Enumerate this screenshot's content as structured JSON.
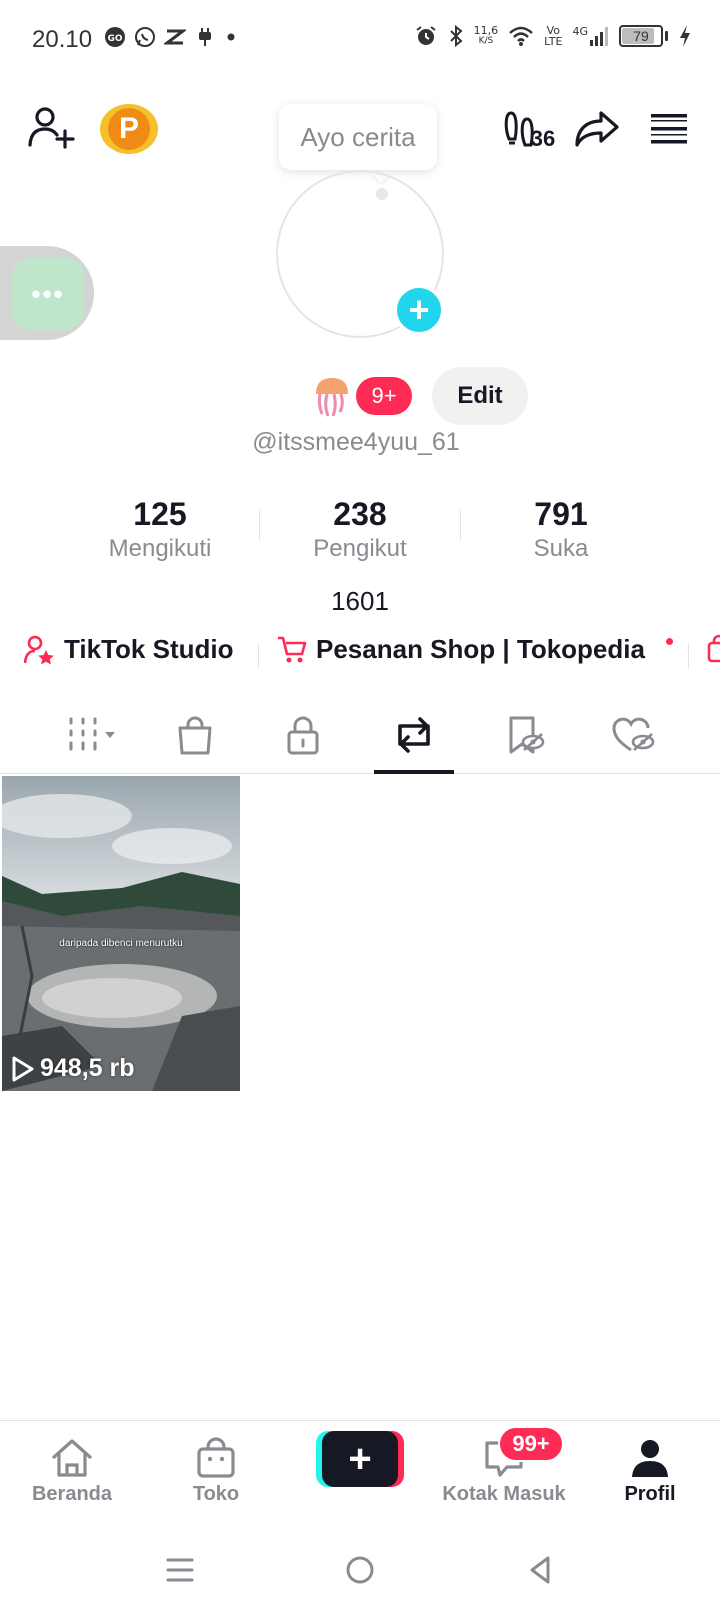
{
  "status_bar": {
    "time": "20.10",
    "net_speed_value": "11,6",
    "net_speed_unit": "K/S",
    "volte_top": "Vo",
    "volte_bottom": "LTE",
    "network": "4G",
    "battery": "79",
    "battery_level": 0.79
  },
  "header": {
    "points_badge": "P",
    "story_bubble": "Ayo cerita",
    "visitors_count": "36"
  },
  "profile": {
    "notification_count": "9+",
    "edit_label": "Edit",
    "username": "@itssmee4yuu_61",
    "bio": "1601"
  },
  "stats": [
    {
      "value": "125",
      "label": "Mengikuti"
    },
    {
      "value": "238",
      "label": "Pengikut"
    },
    {
      "value": "791",
      "label": "Suka"
    }
  ],
  "shortcuts": [
    {
      "label": "TikTok Studio"
    },
    {
      "label": "Pesanan Shop | Tokopedia"
    }
  ],
  "video": {
    "caption": "daripada dibenci menurutku",
    "views": "948,5 rb"
  },
  "bottom_nav": {
    "items": [
      {
        "label": "Beranda"
      },
      {
        "label": "Toko"
      },
      {
        "label": "Kotak Masuk"
      },
      {
        "label": "Profil"
      }
    ],
    "inbox_badge": "99+"
  },
  "colors": {
    "accent_red": "#fe2c55",
    "accent_cyan": "#25f4ee",
    "text_primary": "#161823",
    "text_secondary": "#8a8b91"
  }
}
